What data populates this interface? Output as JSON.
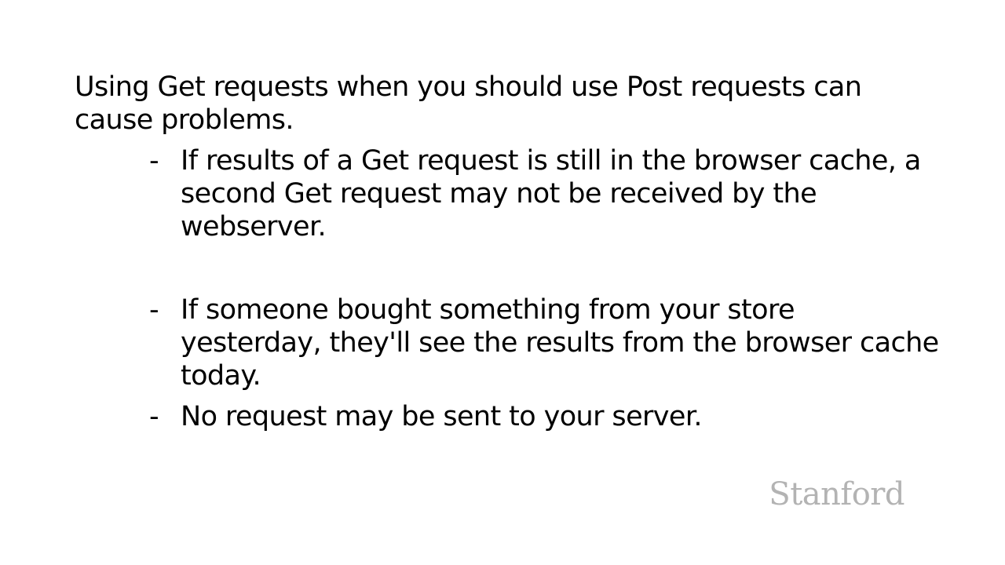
{
  "intro": "Using Get requests when you should use Post requests can cause problems.",
  "bullets": [
    {
      "marker": "-",
      "text": "If results of a Get request is still in the browser cache, a second Get request may not be received by the webserver."
    },
    {
      "marker": "-",
      "text": "If someone bought something from your store yesterday, they'll see the results from the browser cache today."
    },
    {
      "marker": "-",
      "text": "No request may be sent to your server."
    }
  ],
  "logo": "Stanford",
  "colors": {
    "background": "#ffffff",
    "text": "#000000",
    "logo": "#b3b3b3"
  }
}
